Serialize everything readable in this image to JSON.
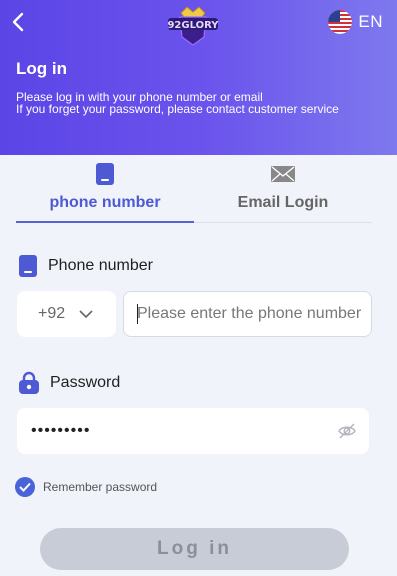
{
  "header": {
    "logo_text": "92GLORY",
    "language": "EN",
    "title": "Log in",
    "subtitle_line1": "Please log in with your phone number or email",
    "subtitle_line2": "If you forget your password, please contact customer service"
  },
  "tabs": [
    {
      "label": "phone number",
      "icon": "phone-icon",
      "active": true
    },
    {
      "label": "Email Login",
      "icon": "email-icon",
      "active": false
    }
  ],
  "phone": {
    "label": "Phone number",
    "country_code": "+92",
    "placeholder": "Please enter the phone number",
    "value": ""
  },
  "password": {
    "label": "Password",
    "value": "•••••••••"
  },
  "remember": {
    "label": "Remember password",
    "checked": true
  },
  "login_button": {
    "label": "Log in"
  },
  "colors": {
    "accent": "#4d5ad3",
    "header_start": "#5b45e6",
    "header_end": "#7e79ee",
    "button_disabled": "#c8ccd6"
  }
}
